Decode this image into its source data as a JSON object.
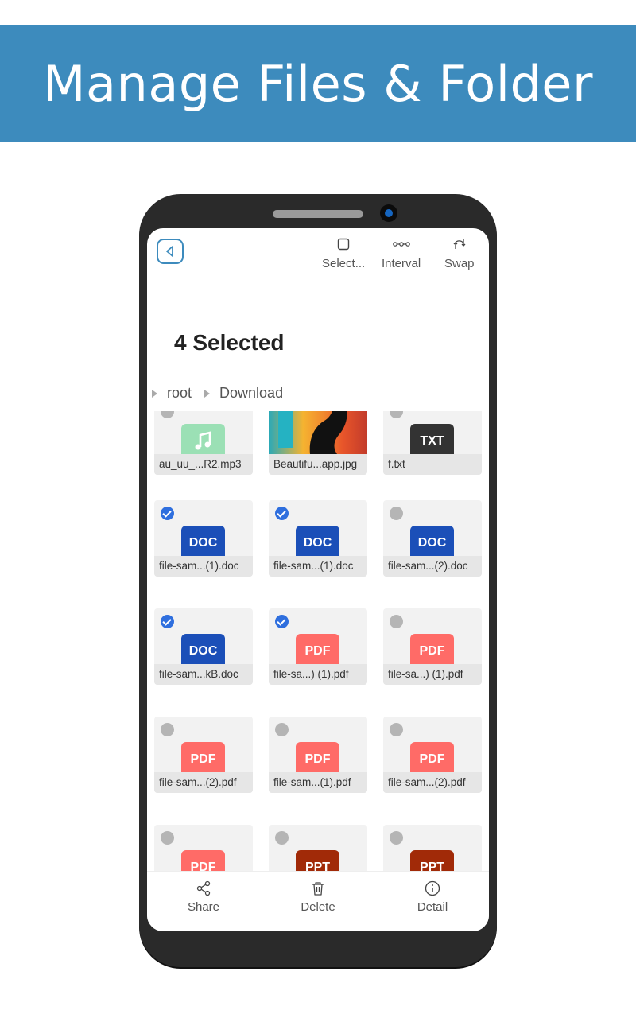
{
  "banner": {
    "title": "Manage Files & Folder"
  },
  "toolbar": {
    "select_label": "Select...",
    "interval_label": "Interval",
    "swap_label": "Swap"
  },
  "header": {
    "selected_title": "4 Selected"
  },
  "breadcrumb": [
    "root",
    "Download"
  ],
  "files": [
    {
      "name": "au_uu_...R2.mp3",
      "type": "music",
      "selected": false
    },
    {
      "name": "Beautifu...app.jpg",
      "type": "image",
      "selected": false
    },
    {
      "name": "f.txt",
      "type": "TXT",
      "selected": false
    },
    {
      "name": "file-sam...(1).doc",
      "type": "DOC",
      "selected": true
    },
    {
      "name": "file-sam...(1).doc",
      "type": "DOC",
      "selected": true
    },
    {
      "name": "file-sam...(2).doc",
      "type": "DOC",
      "selected": false
    },
    {
      "name": "file-sam...kB.doc",
      "type": "DOC",
      "selected": true
    },
    {
      "name": "file-sa...) (1).pdf",
      "type": "PDF",
      "selected": true
    },
    {
      "name": "file-sa...) (1).pdf",
      "type": "PDF",
      "selected": false
    },
    {
      "name": "file-sam...(2).pdf",
      "type": "PDF",
      "selected": false
    },
    {
      "name": "file-sam...(1).pdf",
      "type": "PDF",
      "selected": false
    },
    {
      "name": "file-sam...(2).pdf",
      "type": "PDF",
      "selected": false
    },
    {
      "name": "",
      "type": "PDF",
      "selected": false
    },
    {
      "name": "",
      "type": "PPT",
      "selected": false
    },
    {
      "name": "",
      "type": "PPT",
      "selected": false
    }
  ],
  "bottom_bar": {
    "share_label": "Share",
    "delete_label": "Delete",
    "detail_label": "Detail"
  },
  "colors": {
    "banner": "#3d8bbd",
    "doc": "#1b4fb8",
    "pdf": "#ff6b67",
    "ppt": "#a12a08",
    "txt": "#333333",
    "check": "#2f6fde"
  }
}
